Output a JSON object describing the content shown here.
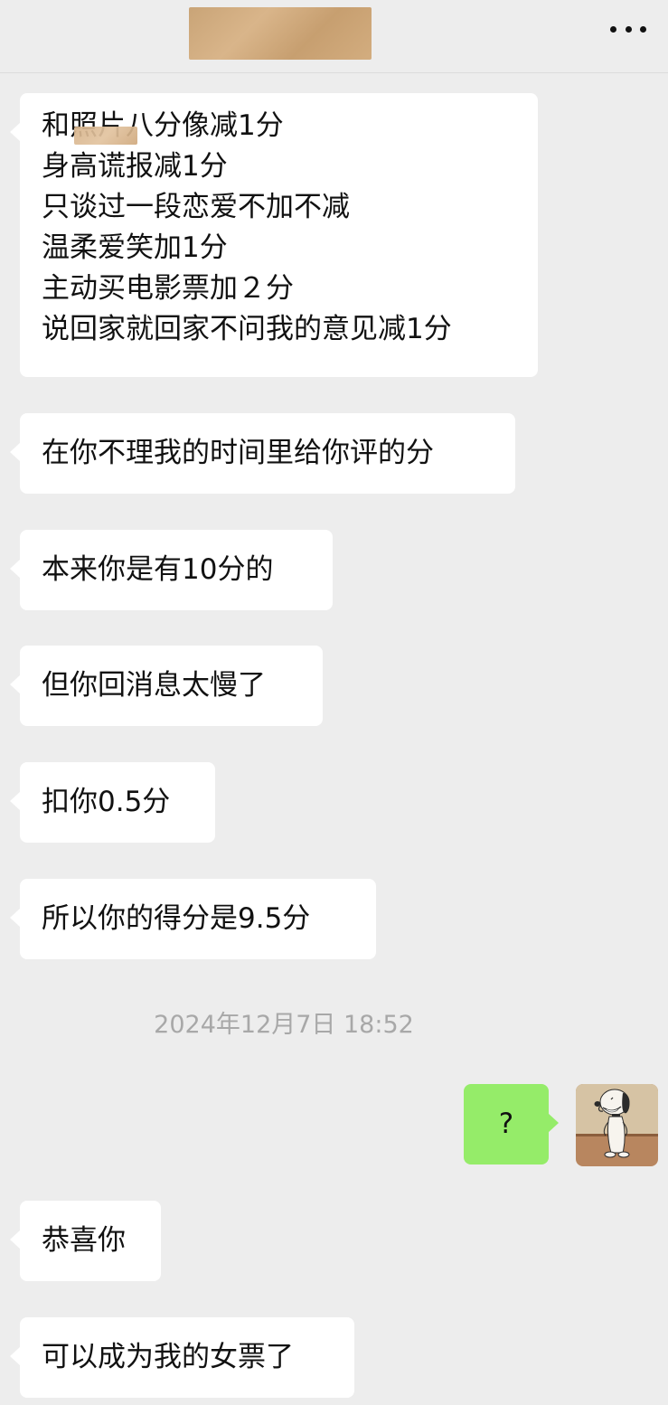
{
  "header": {
    "more_icon": "more-horizontal-icon"
  },
  "messages": [
    {
      "side": "left",
      "text": "和照片八分像减1分\n身高谎报减1分\n只谈过一段恋爱不加不减\n温柔爱笑加1分\n主动买电影票加２分\n说回家就回家不问我的意见减1分"
    },
    {
      "side": "left",
      "text": "在你不理我的时间里给你评的分"
    },
    {
      "side": "left",
      "text": "本来你是有10分的"
    },
    {
      "side": "left",
      "text": "但你回消息太慢了"
    },
    {
      "side": "left",
      "text": "扣你0.5分"
    },
    {
      "side": "left",
      "text": "所以你的得分是9.5分"
    },
    {
      "side": "right",
      "text": "?"
    },
    {
      "side": "left",
      "text": "恭喜你"
    },
    {
      "side": "left",
      "text": "可以成为我的女票了"
    }
  ],
  "timestamp": "2024年12月7日 18:52",
  "colors": {
    "background": "#ededed",
    "incoming_bubble": "#ffffff",
    "outgoing_bubble": "#95ec69",
    "timestamp_text": "#a8a8a8"
  },
  "avatar": {
    "icon": "snoopy-avatar-icon"
  }
}
